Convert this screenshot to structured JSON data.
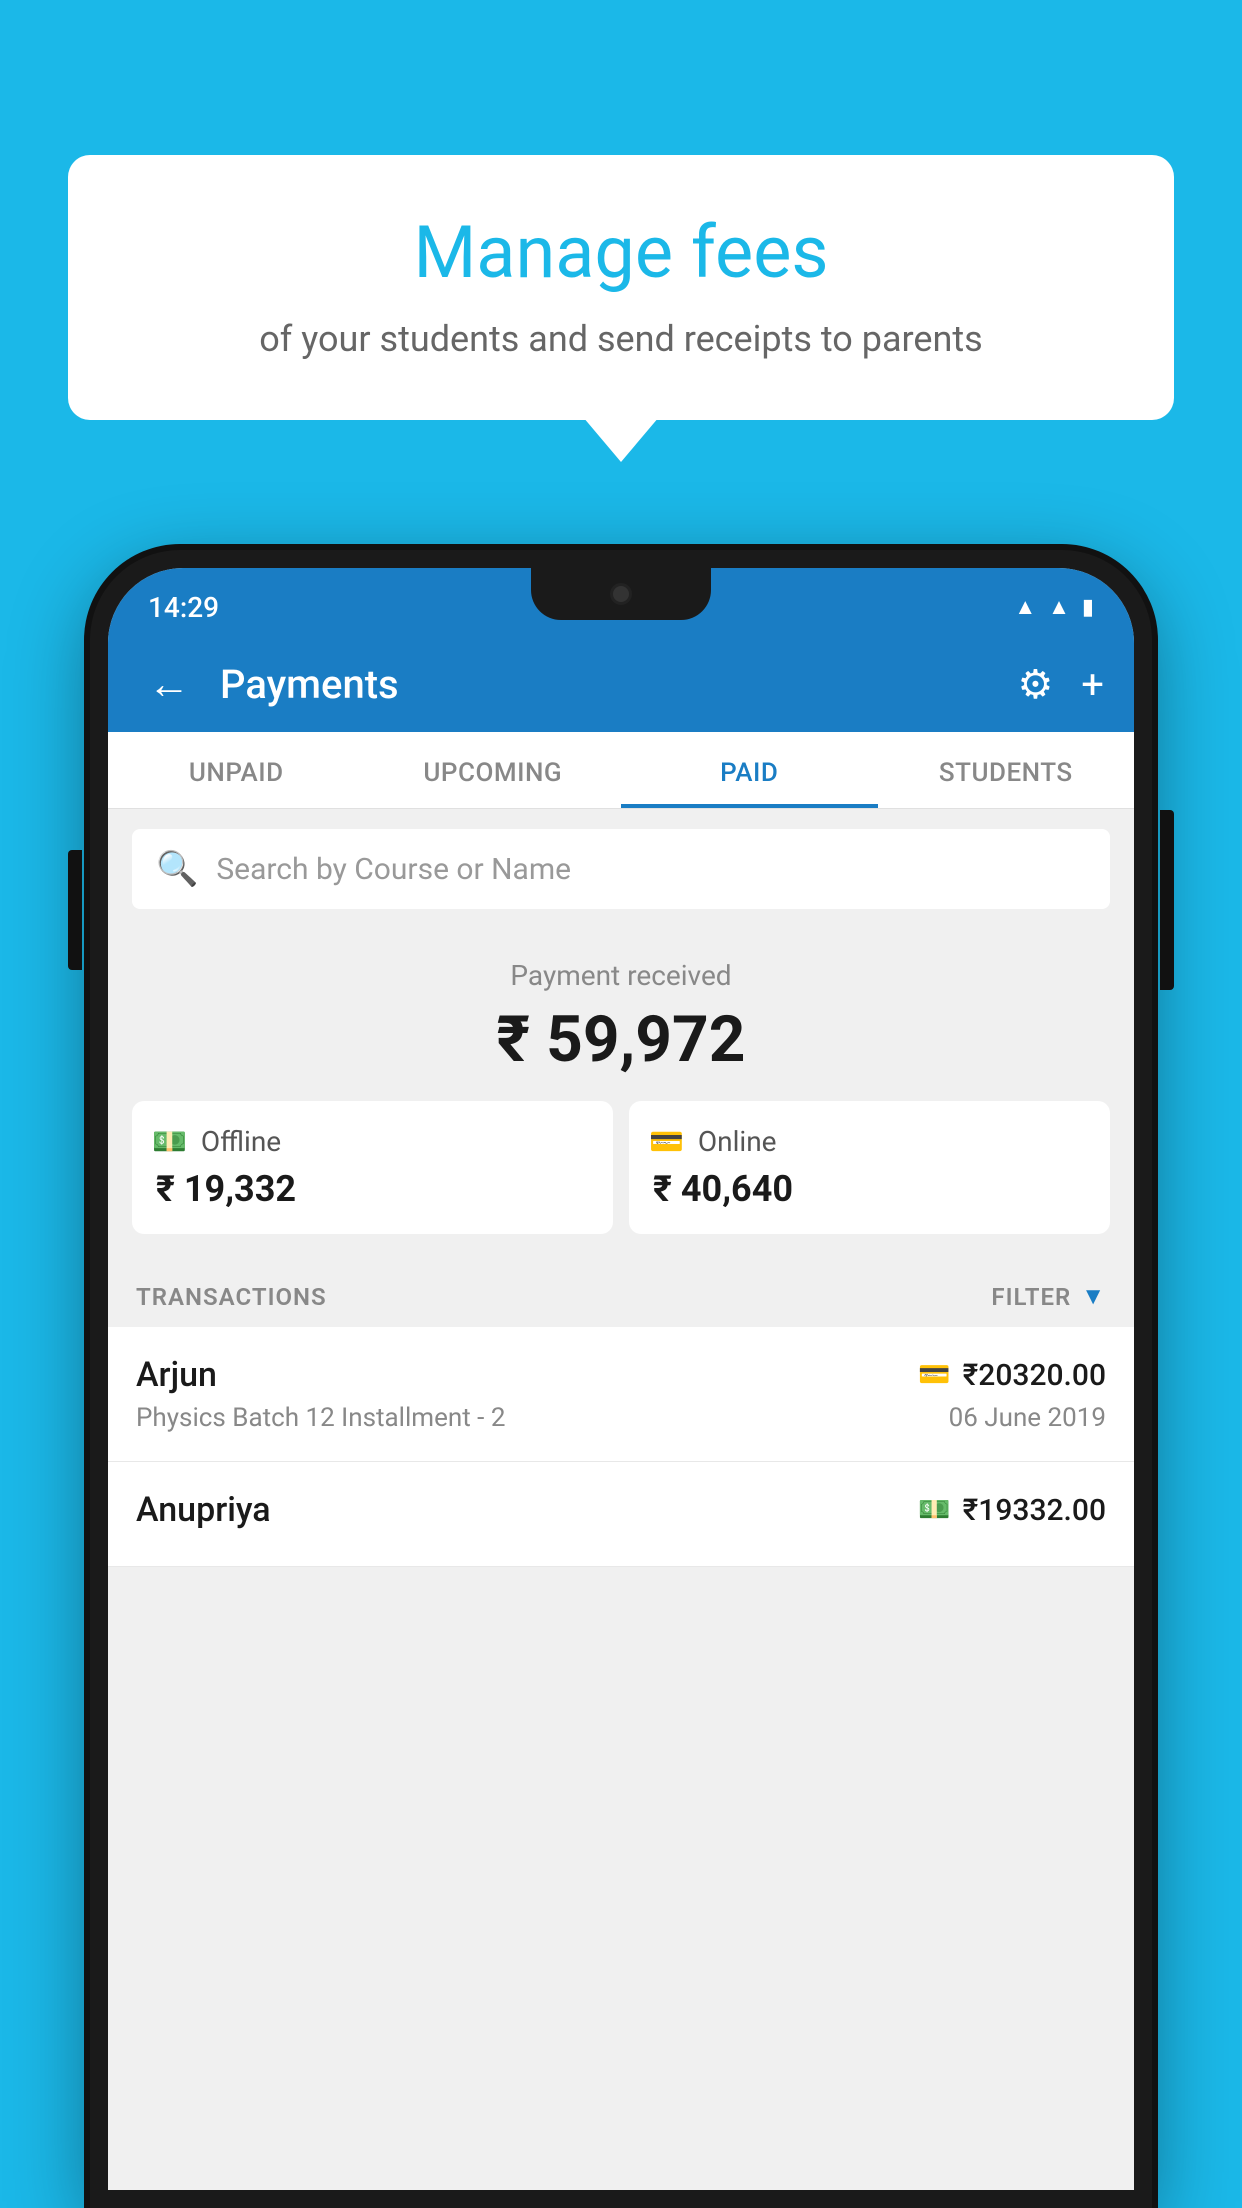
{
  "background_color": "#1BB8E8",
  "bubble": {
    "title": "Manage fees",
    "subtitle": "of your students and send receipts to parents"
  },
  "status_bar": {
    "time": "14:29"
  },
  "header": {
    "title": "Payments",
    "back_label": "←"
  },
  "tabs": [
    {
      "id": "unpaid",
      "label": "UNPAID",
      "active": false
    },
    {
      "id": "upcoming",
      "label": "UPCOMING",
      "active": false
    },
    {
      "id": "paid",
      "label": "PAID",
      "active": true
    },
    {
      "id": "students",
      "label": "STUDENTS",
      "active": false
    }
  ],
  "search": {
    "placeholder": "Search by Course or Name"
  },
  "payment_summary": {
    "label": "Payment received",
    "total": "₹ 59,972",
    "offline": {
      "label": "Offline",
      "amount": "₹ 19,332"
    },
    "online": {
      "label": "Online",
      "amount": "₹ 40,640"
    }
  },
  "transactions": {
    "label": "TRANSACTIONS",
    "filter_label": "FILTER",
    "items": [
      {
        "name": "Arjun",
        "course": "Physics Batch 12 Installment - 2",
        "date": "06 June 2019",
        "amount": "₹20320.00",
        "payment_type": "card"
      },
      {
        "name": "Anupriya",
        "course": "",
        "date": "",
        "amount": "₹19332.00",
        "payment_type": "cash"
      }
    ]
  }
}
